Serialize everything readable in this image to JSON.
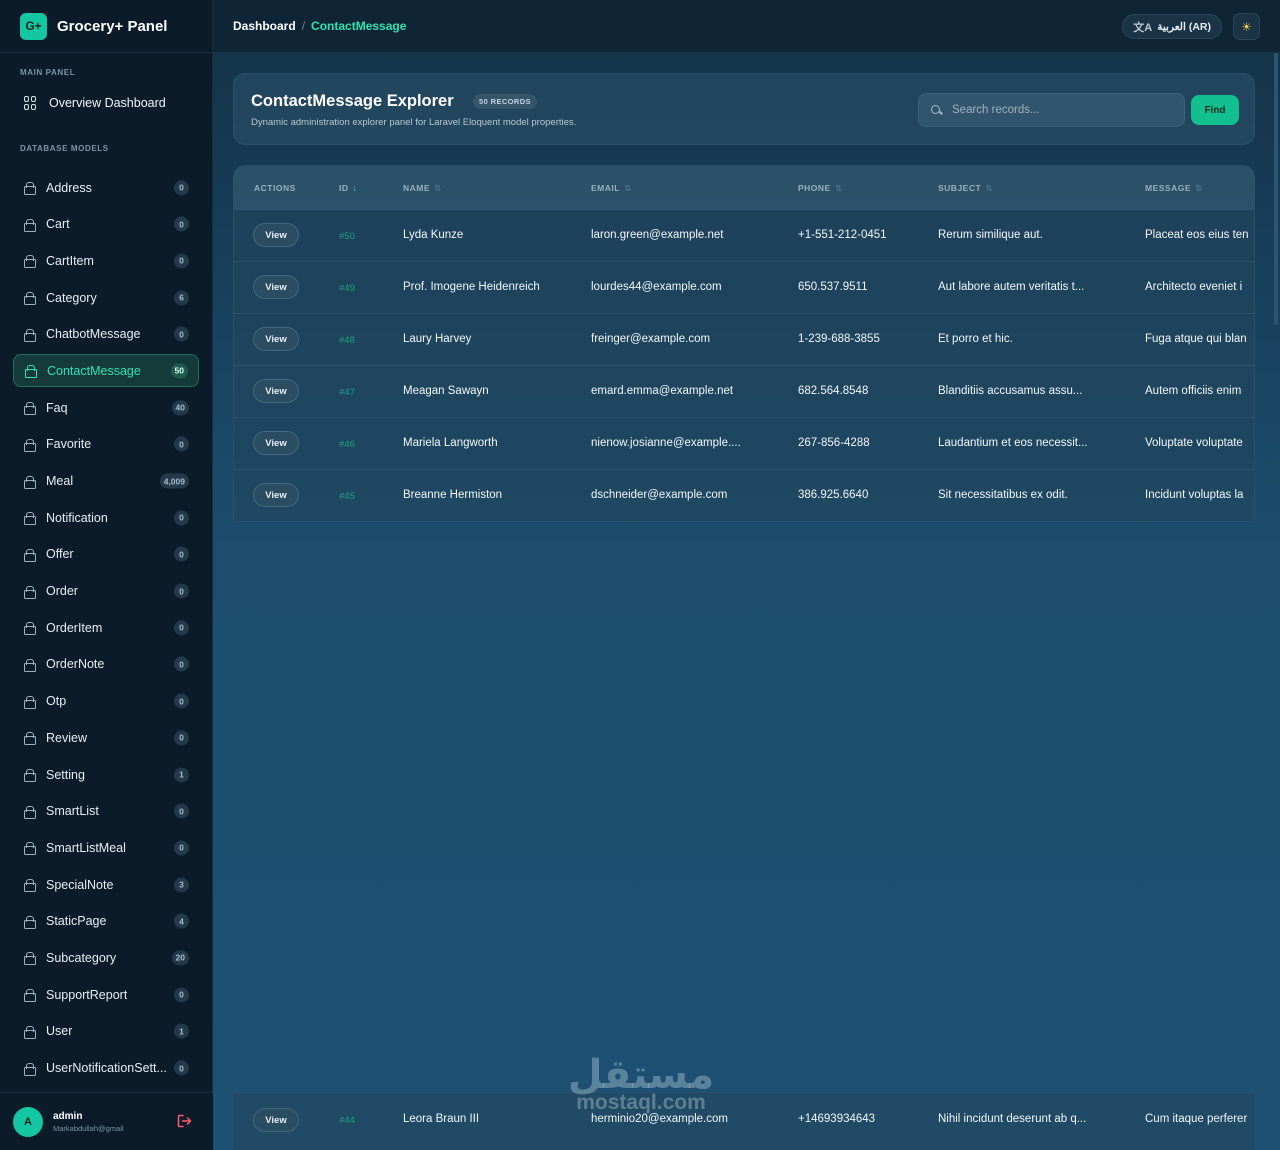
{
  "brand": {
    "logo": "G+",
    "name": "Grocery+ Panel"
  },
  "sidebar": {
    "main_label": "MAIN PANEL",
    "overview_label": "Overview Dashboard",
    "models_label": "DATABASE MODELS",
    "items": [
      {
        "label": "Address",
        "count": "0"
      },
      {
        "label": "Cart",
        "count": "0"
      },
      {
        "label": "CartItem",
        "count": "0"
      },
      {
        "label": "Category",
        "count": "6"
      },
      {
        "label": "ChatbotMessage",
        "count": "0"
      },
      {
        "label": "ContactMessage",
        "count": "50",
        "active": true
      },
      {
        "label": "Faq",
        "count": "40"
      },
      {
        "label": "Favorite",
        "count": "0"
      },
      {
        "label": "Meal",
        "count": "4,009"
      },
      {
        "label": "Notification",
        "count": "0"
      },
      {
        "label": "Offer",
        "count": "0"
      },
      {
        "label": "Order",
        "count": "0"
      },
      {
        "label": "OrderItem",
        "count": "0"
      },
      {
        "label": "OrderNote",
        "count": "0"
      },
      {
        "label": "Otp",
        "count": "0"
      },
      {
        "label": "Review",
        "count": "0"
      },
      {
        "label": "Setting",
        "count": "1"
      },
      {
        "label": "SmartList",
        "count": "0"
      },
      {
        "label": "SmartListMeal",
        "count": "0"
      },
      {
        "label": "SpecialNote",
        "count": "3"
      },
      {
        "label": "StaticPage",
        "count": "4"
      },
      {
        "label": "Subcategory",
        "count": "20"
      },
      {
        "label": "SupportReport",
        "count": "0"
      },
      {
        "label": "User",
        "count": "1"
      },
      {
        "label": "UserNotificationSett...",
        "count": "0"
      }
    ]
  },
  "user": {
    "initial": "A",
    "name": "admin",
    "email": "Markabdullah@gmail"
  },
  "topbar": {
    "crumb_root": "Dashboard",
    "crumb_sep": "/",
    "crumb_current": "ContactMessage",
    "language": "العربية (AR)",
    "language_icon": "translate-icon",
    "theme_icon": "sun-icon"
  },
  "header": {
    "title": "ContactMessage Explorer",
    "badge": "50 RECORDS",
    "subtitle": "Dynamic administration explorer panel for Laravel Eloquent model properties.",
    "search_placeholder": "Search records...",
    "find_label": "Find"
  },
  "table": {
    "columns": [
      "ACTIONS",
      "ID",
      "NAME",
      "EMAIL",
      "PHONE",
      "SUBJECT",
      "MESSAGE"
    ],
    "view_label": "View",
    "rows": [
      {
        "id": "#50",
        "name": "Lyda Kunze",
        "email": "laron.green@example.net",
        "phone": "+1-551-212-0451",
        "subject": "Rerum similique aut.",
        "message": "Placeat eos eius ten"
      },
      {
        "id": "#49",
        "name": "Prof. Imogene Heidenreich",
        "email": "lourdes44@example.com",
        "phone": "650.537.9511",
        "subject": "Aut labore autem veritatis t...",
        "message": "Architecto eveniet i"
      },
      {
        "id": "#48",
        "name": "Laury Harvey",
        "email": "freinger@example.com",
        "phone": "1-239-688-3855",
        "subject": "Et porro et hic.",
        "message": "Fuga atque qui blan"
      },
      {
        "id": "#47",
        "name": "Meagan Sawayn",
        "email": "emard.emma@example.net",
        "phone": "682.564.8548",
        "subject": "Blanditiis accusamus assu...",
        "message": "Autem officiis enim"
      },
      {
        "id": "#46",
        "name": "Mariela Langworth",
        "email": "nienow.josianne@example....",
        "phone": "267-856-4288",
        "subject": "Laudantium et eos necessit...",
        "message": "Voluptate voluptate"
      },
      {
        "id": "#45",
        "name": "Breanne Hermiston",
        "email": "dschneider@example.com",
        "phone": "386.925.6640",
        "subject": "Sit necessitatibus ex odit.",
        "message": "Incidunt voluptas la"
      }
    ],
    "bottom_row": {
      "id": "#44",
      "name": "Leora Braun III",
      "email": "herminio20@example.com",
      "phone": "+14693934643",
      "subject": "Nihil incidunt deserunt ab q...",
      "message": "Cum itaque perferer"
    }
  },
  "watermark": {
    "arabic": "مستقل",
    "latin": "mostaql.com"
  },
  "colors": {
    "accent": "#2fe3b4",
    "button_green": "#12c08f",
    "sidebar_bg": "#0b1b29",
    "main_bg": "#1c4d6e"
  }
}
